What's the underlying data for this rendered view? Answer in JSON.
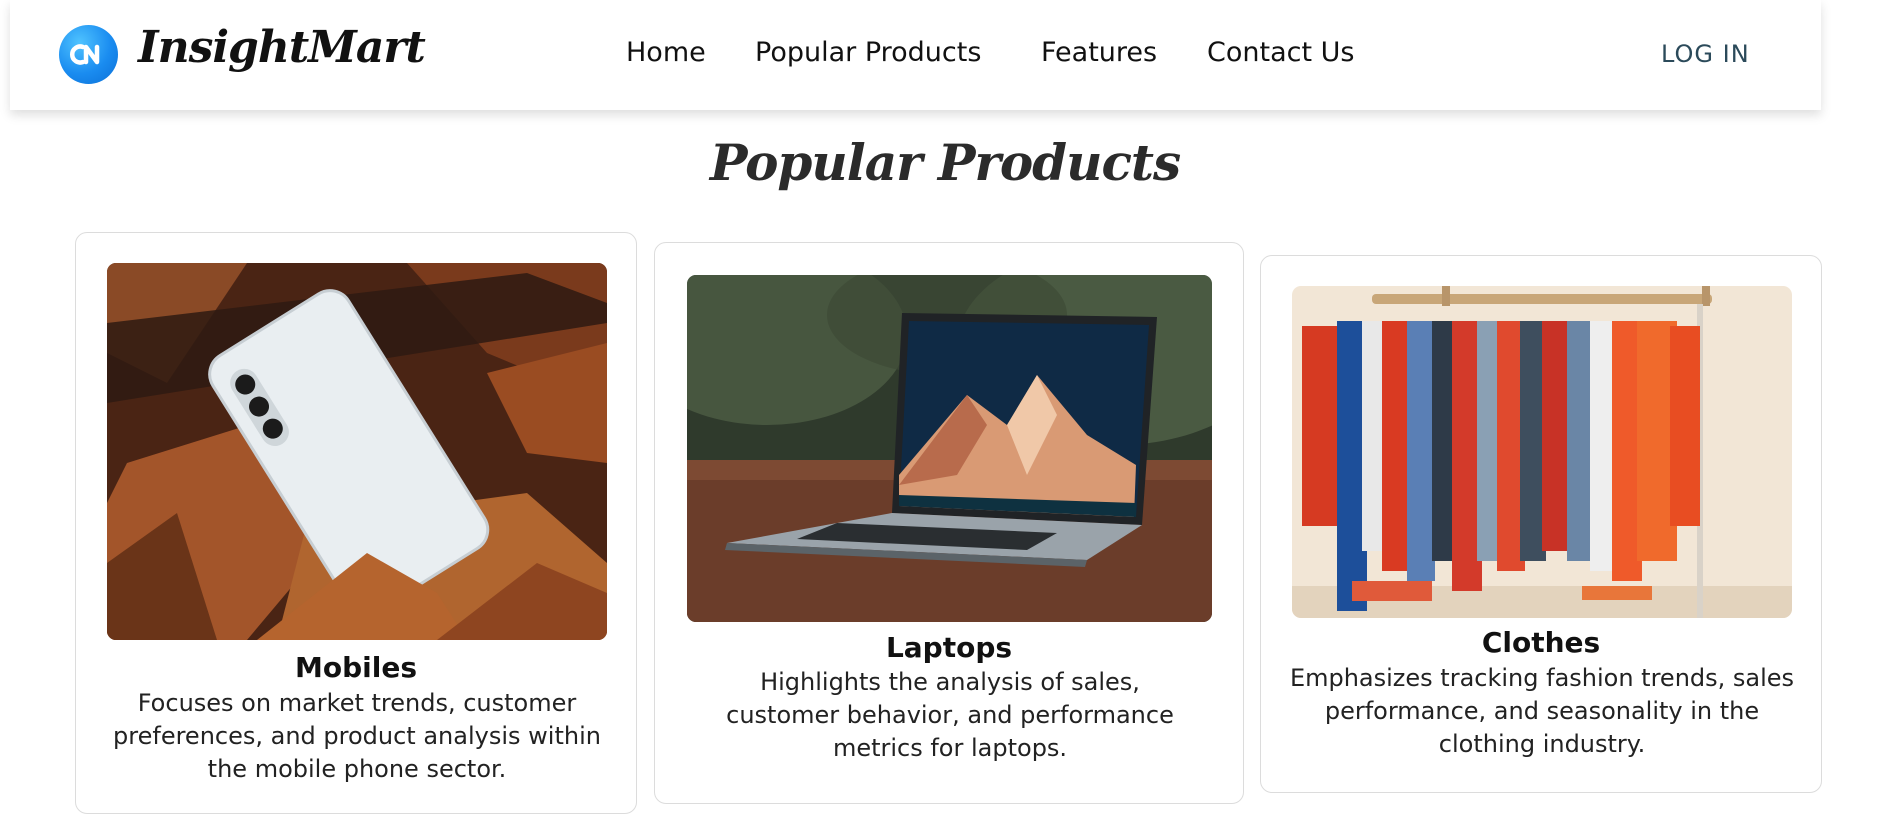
{
  "brand": {
    "name": "InsightMart",
    "logo_icon": "insightmart-logo-icon"
  },
  "nav": {
    "links": [
      "Home",
      "Popular Products",
      "Features",
      "Contact Us"
    ],
    "login_label": "LOG IN"
  },
  "section": {
    "title": "Popular Products"
  },
  "products": [
    {
      "title": "Mobiles",
      "description": "Focuses on market trends, customer preferences, and product analysis within the mobile phone sector.",
      "image": "smartphone-in-autumn-leaves-photo"
    },
    {
      "title": "Laptops",
      "description": "Highlights the analysis of sales, customer behavior, and performance metrics for laptops.",
      "image": "laptop-on-table-photo"
    },
    {
      "title": "Clothes",
      "description": "Emphasizes tracking fashion trends, sales performance, and seasonality in the clothing industry.",
      "image": "clothing-rack-photo"
    }
  ],
  "colors": {
    "logo_blue": "#1a8cf0",
    "login_text": "#2b4a5a"
  }
}
